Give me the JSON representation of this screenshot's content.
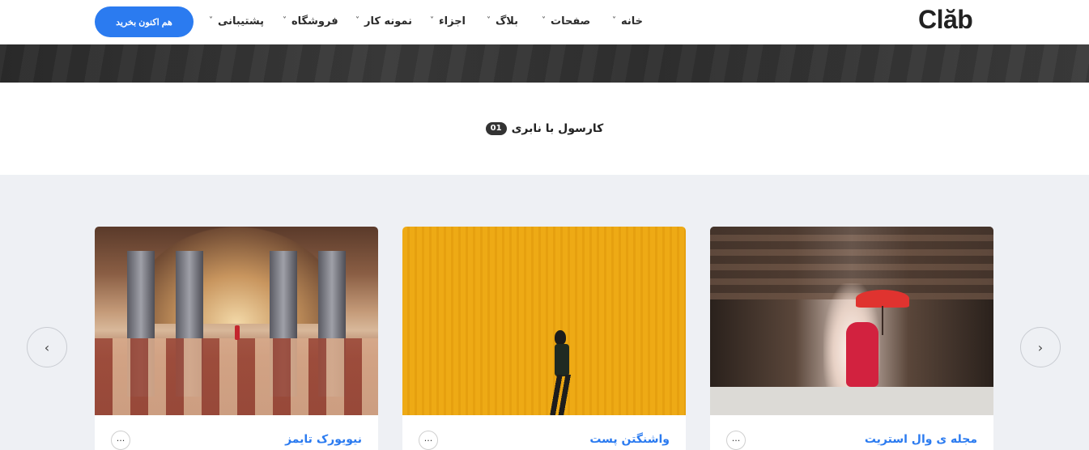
{
  "header": {
    "logo": "Clăb",
    "buy_button": "هم اکنون بخرید",
    "nav": [
      {
        "label": "خانه"
      },
      {
        "label": "صفحات"
      },
      {
        "label": "بلاگ"
      },
      {
        "label": "اجزاء"
      },
      {
        "label": "نمونه کار"
      },
      {
        "label": "فروشگاه"
      },
      {
        "label": "پشتیبانی"
      }
    ],
    "chevron": "˅"
  },
  "section": {
    "title": "کارسول با نابری",
    "badge": "01"
  },
  "carousel": {
    "prev_arrow": "‹",
    "next_arrow": "›",
    "cards": [
      {
        "title": "مجله ی وال استریت",
        "more": "···",
        "image": "monk-corridor-photo"
      },
      {
        "title": "واشنگتن پست",
        "more": "···",
        "image": "yellow-wall-photo"
      },
      {
        "title": "نیویورک تایمز",
        "more": "···",
        "image": "subway-hall-photo"
      }
    ]
  },
  "colors": {
    "accent": "#2b7bf0",
    "carousel_bg": "#eef0f4"
  }
}
